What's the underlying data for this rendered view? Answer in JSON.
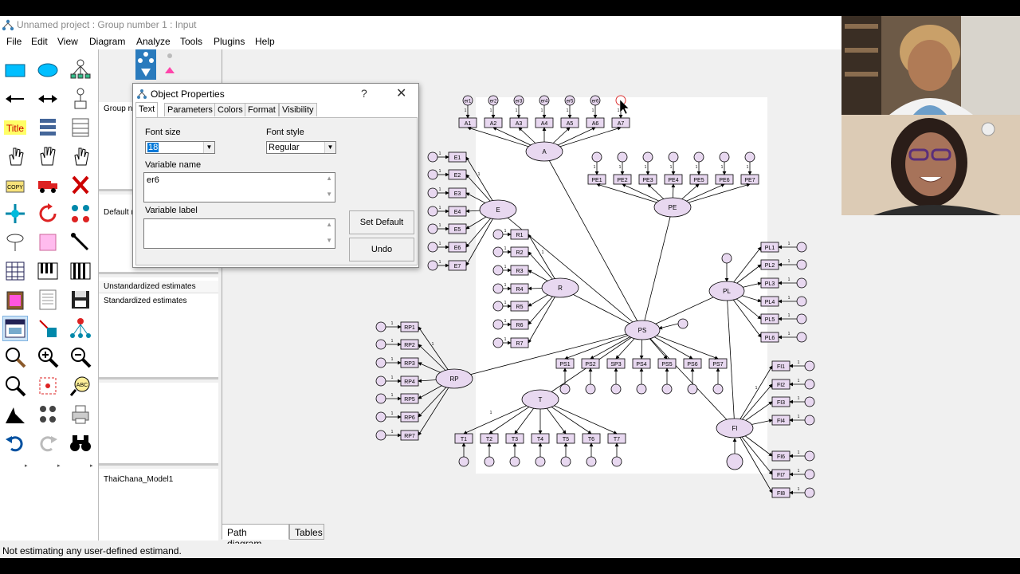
{
  "window": {
    "title": "Unnamed project : Group number 1 : Input"
  },
  "menu": [
    "File",
    "Edit",
    "View",
    "Diagram",
    "Analyze",
    "Tools",
    "Plugins",
    "Help"
  ],
  "toolbox": {
    "title_tool_label": "Title"
  },
  "midpanel": {
    "group_label": "Group n",
    "default_label": "Default m",
    "estimates": [
      "Unstandardized estimates",
      "Standardized estimates"
    ],
    "model_name": "ThaiChana_Model1"
  },
  "dialog": {
    "title": "Object Properties",
    "help": "?",
    "close": "✕",
    "tabs": [
      "Text",
      "Parameters",
      "Colors",
      "Format",
      "Visibility"
    ],
    "font_size_label": "Font size",
    "font_size_value": "18",
    "font_style_label": "Font style",
    "font_style_value": "Regular",
    "variable_name_label": "Variable name",
    "variable_name_value": "er6",
    "variable_label_label": "Variable label",
    "variable_label_value": "",
    "set_default": "Set Default",
    "undo": "Undo"
  },
  "tabs": [
    "Path diagram",
    "Tables"
  ],
  "status": "Not estimating any user-defined estimand.",
  "diagram": {
    "latents": [
      "A",
      "E",
      "R",
      "PE",
      "PS",
      "PL",
      "RP",
      "T",
      "FI"
    ],
    "errors_top": [
      "er1",
      "er2",
      "er3",
      "er4",
      "er5",
      "er6"
    ],
    "groups": {
      "A": [
        "A1",
        "A2",
        "A3",
        "A4",
        "A5",
        "A6",
        "A7"
      ],
      "E": [
        "E1",
        "E2",
        "E3",
        "E4",
        "E5",
        "E6",
        "E7"
      ],
      "R": [
        "R1",
        "R2",
        "R3",
        "R4",
        "R5",
        "R6",
        "R7"
      ],
      "PE": [
        "PE1",
        "PE2",
        "PE3",
        "PE4",
        "PE5",
        "PE6",
        "PE7"
      ],
      "PS": [
        "PS1",
        "PS2",
        "SP3",
        "PS4",
        "PS5",
        "PS6",
        "PS7"
      ],
      "PL": [
        "PL1",
        "PL2",
        "PL3",
        "PL4",
        "PL5",
        "PL6"
      ],
      "RP": [
        "RP1",
        "RP2",
        "RP3",
        "RP4",
        "RP5",
        "RP6",
        "RP7"
      ],
      "T": [
        "T1",
        "T2",
        "T3",
        "T4",
        "T5",
        "T6",
        "T7"
      ],
      "FI": [
        "FI1",
        "FI2",
        "FI3",
        "FI4",
        "FI6",
        "FI7",
        "FI8"
      ]
    },
    "path_weight": "1"
  }
}
